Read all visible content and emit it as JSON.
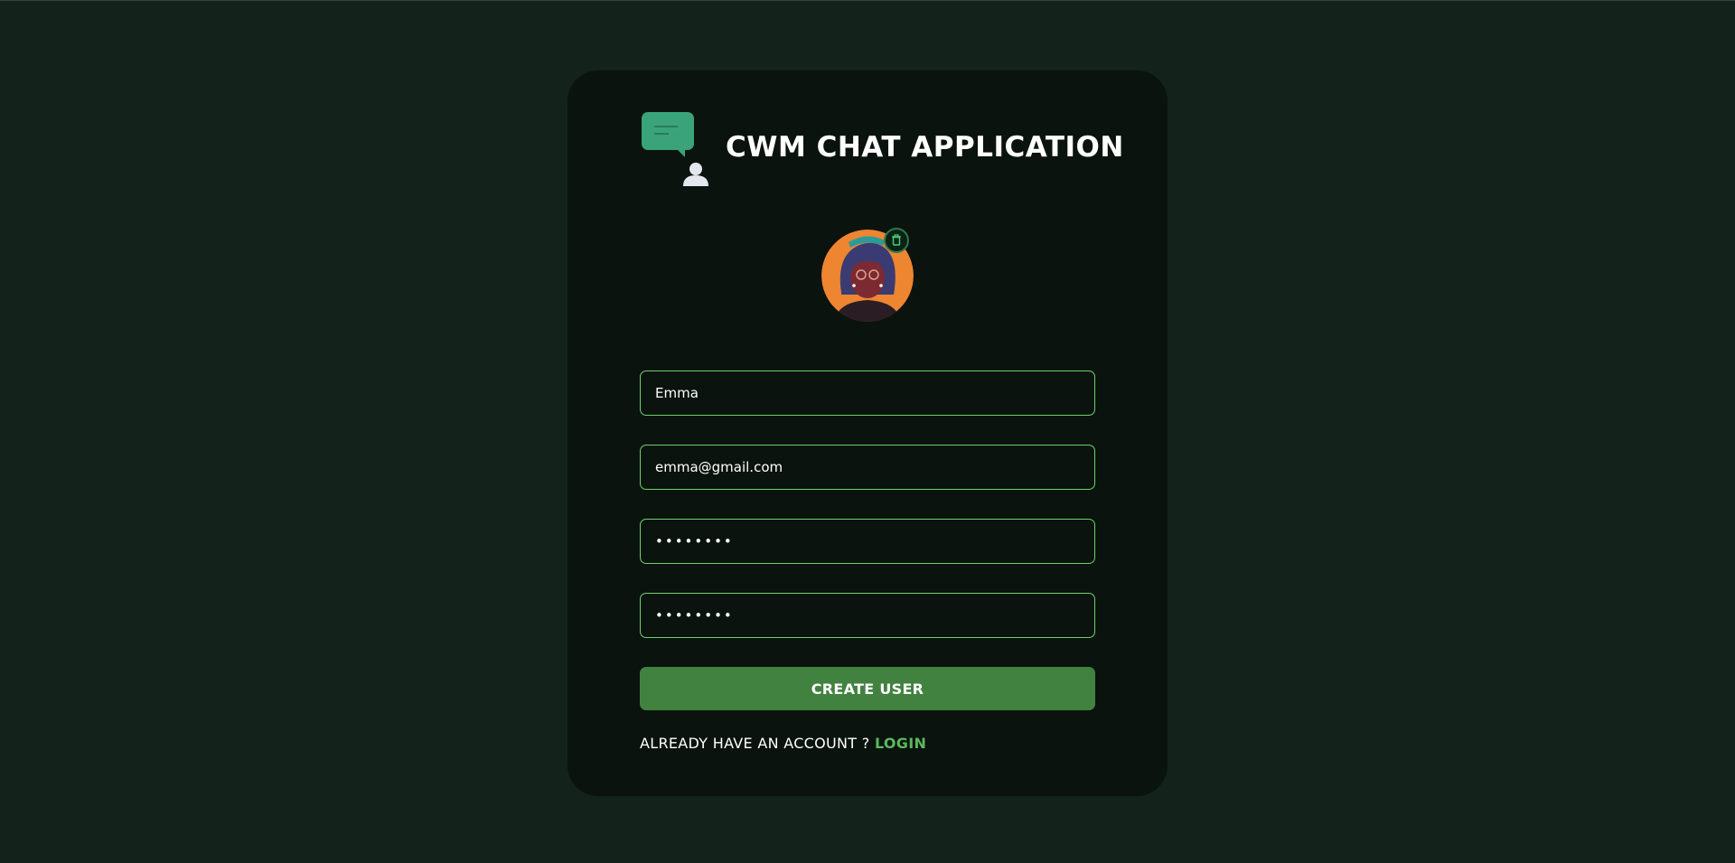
{
  "app": {
    "title": "CWM CHAT APPLICATION",
    "logo_icon": "chat-bubble-user-icon",
    "accent_color": "#3aa37a"
  },
  "avatar": {
    "image": "avatar-illustration",
    "delete_icon": "trash-icon"
  },
  "form": {
    "name_value": "Emma",
    "email_value": "emma@gmail.com",
    "password_value": "••••••••",
    "confirm_password_value": "••••••••",
    "field_border_color": "#6fd16a",
    "submit_label": "CREATE USER",
    "submit_color": "#428240"
  },
  "footer": {
    "prompt": "ALREADY HAVE AN ACCOUNT ? ",
    "login_label": "LOGIN",
    "login_color": "#5cb85c"
  }
}
